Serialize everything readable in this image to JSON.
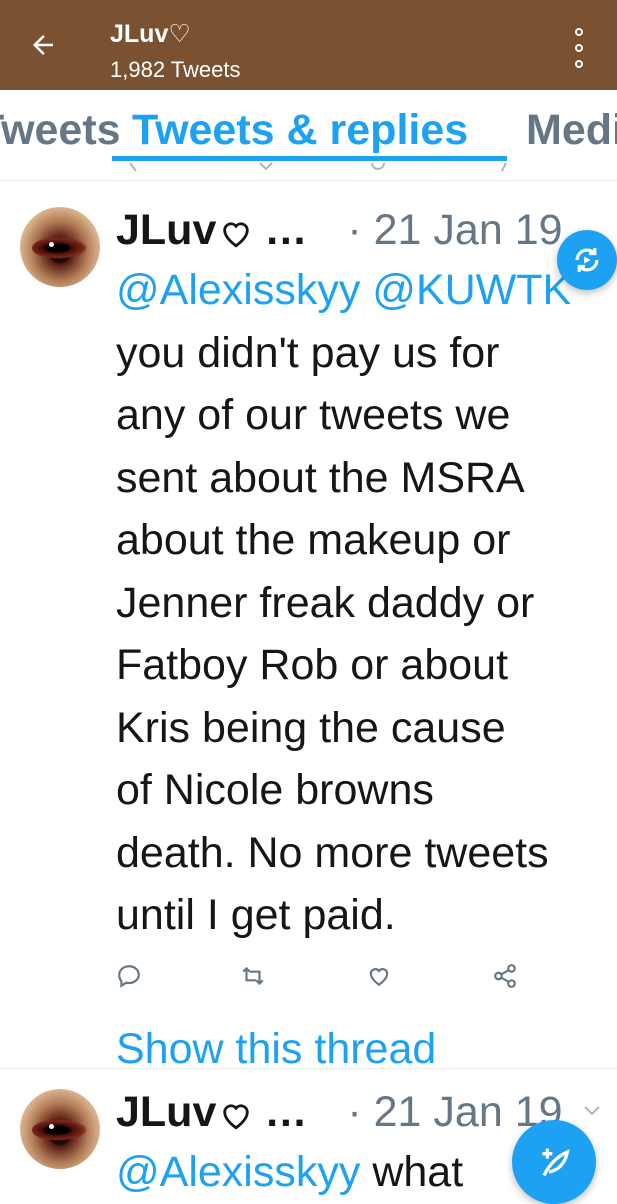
{
  "header": {
    "title": "JLuv♡",
    "subtitle": "1,982 Tweets"
  },
  "tabs": [
    {
      "label": "Tweets"
    },
    {
      "label": "Tweets & replies"
    },
    {
      "label": "Media"
    }
  ],
  "tweets": [
    {
      "name": "JLuv",
      "ellipsis": "…",
      "date": "· 21 Jan 19",
      "mentions": "@Alexisskyy @KUWTK",
      "lines": [
        "you didn't pay us for",
        "any of our tweets we",
        "sent about the MSRA",
        "about the makeup or",
        "Jenner freak daddy or",
        "Fatboy Rob or about",
        "Kris being the cause",
        "of Nicole browns",
        "death. No more tweets",
        "until I get paid."
      ],
      "thread_link": "Show this thread"
    },
    {
      "name": "JLuv",
      "ellipsis": "…",
      "date": "· 21 Jan 19",
      "mention": "@Alexisskyy",
      "text_start": "what"
    }
  ],
  "colors": {
    "appbar": "#7a5232",
    "accent": "#1da1f2",
    "muted": "#657786"
  },
  "icons": [
    "back-arrow-icon",
    "overflow-menu-icon",
    "refresh-icon",
    "reply-icon",
    "retweet-icon",
    "like-icon",
    "share-icon",
    "compose-icon",
    "chevron-down-icon"
  ]
}
